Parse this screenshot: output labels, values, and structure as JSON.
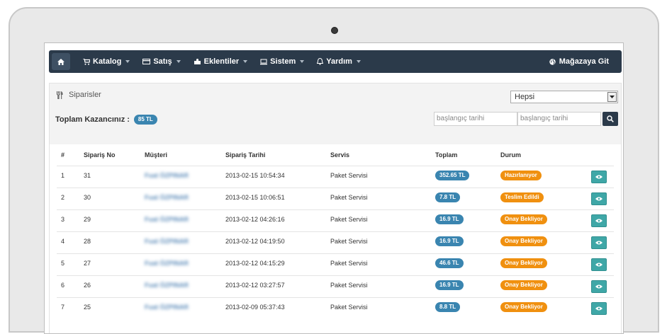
{
  "nav": {
    "items": [
      {
        "label": "Katalog",
        "icon": "cart-icon"
      },
      {
        "label": "Satış",
        "icon": "credit-card-icon"
      },
      {
        "label": "Eklentiler",
        "icon": "puzzle-icon"
      },
      {
        "label": "Sistem",
        "icon": "system-icon"
      },
      {
        "label": "Yardım",
        "icon": "bell-icon"
      }
    ],
    "store_link": "Mağazaya Git"
  },
  "panel": {
    "title": "Siparisler",
    "filter_value": "Hepsi",
    "earnings_label": "Toplam Kazancınız :",
    "earnings_value": "85 TL",
    "start_date_placeholder": "başlangıç tarihi",
    "end_date_placeholder": "başlangıç tarihi"
  },
  "table": {
    "headers": [
      "#",
      "Sipariş No",
      "Müşteri",
      "Sipariş Tarihi",
      "Servis",
      "Toplam",
      "Durum"
    ],
    "rows": [
      {
        "idx": "1",
        "order_no": "31",
        "customer": "Fuat ÖZPINAR",
        "date": "2013-02-15 10:54:34",
        "service": "Paket Servisi",
        "total": "352.65 TL",
        "status": "Hazırlanıyor"
      },
      {
        "idx": "2",
        "order_no": "30",
        "customer": "Fuat ÖZPINAR",
        "date": "2013-02-15 10:06:51",
        "service": "Paket Servisi",
        "total": "7.8 TL",
        "status": "Teslim Edildi"
      },
      {
        "idx": "3",
        "order_no": "29",
        "customer": "Fuat ÖZPINAR",
        "date": "2013-02-12 04:26:16",
        "service": "Paket Servisi",
        "total": "16.9 TL",
        "status": "Onay Bekliyor"
      },
      {
        "idx": "4",
        "order_no": "28",
        "customer": "Fuat ÖZPINAR",
        "date": "2013-02-12 04:19:50",
        "service": "Paket Servisi",
        "total": "16.9 TL",
        "status": "Onay Bekliyor"
      },
      {
        "idx": "5",
        "order_no": "27",
        "customer": "Fuat ÖZPINAR",
        "date": "2013-02-12 04:15:29",
        "service": "Paket Servisi",
        "total": "46.6 TL",
        "status": "Onay Bekliyor"
      },
      {
        "idx": "6",
        "order_no": "26",
        "customer": "Fuat ÖZPINAR",
        "date": "2013-02-12 03:27:57",
        "service": "Paket Servisi",
        "total": "16.9 TL",
        "status": "Onay Bekliyor"
      },
      {
        "idx": "7",
        "order_no": "25",
        "customer": "Fuat ÖZPINAR",
        "date": "2013-02-09 05:37:43",
        "service": "Paket Servisi",
        "total": "8.8 TL",
        "status": "Onay Bekliyor"
      }
    ]
  },
  "colors": {
    "navbar": "#2b3a4a",
    "total_badge": "#3a85b0",
    "status_badge": "#f0900f",
    "view_button": "#3fa7a7"
  }
}
